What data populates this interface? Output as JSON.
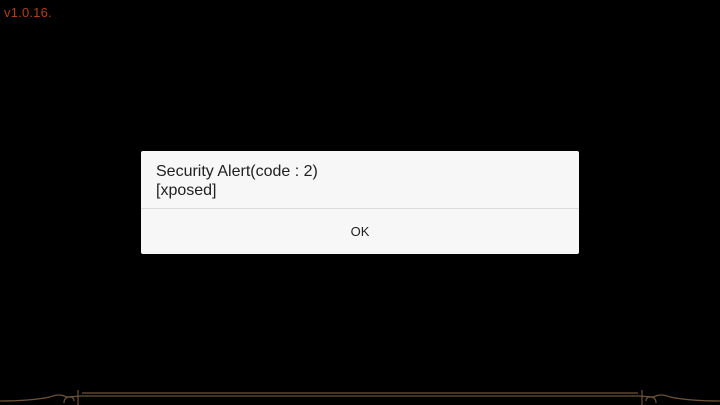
{
  "app": {
    "version": "v1.0.16.",
    "background_color": "#000000",
    "version_color": "#b0401a",
    "frame_color": "#6b5236"
  },
  "dialog": {
    "title": "Security Alert(code : 2)",
    "message": "[xposed]",
    "ok_label": "OK"
  }
}
